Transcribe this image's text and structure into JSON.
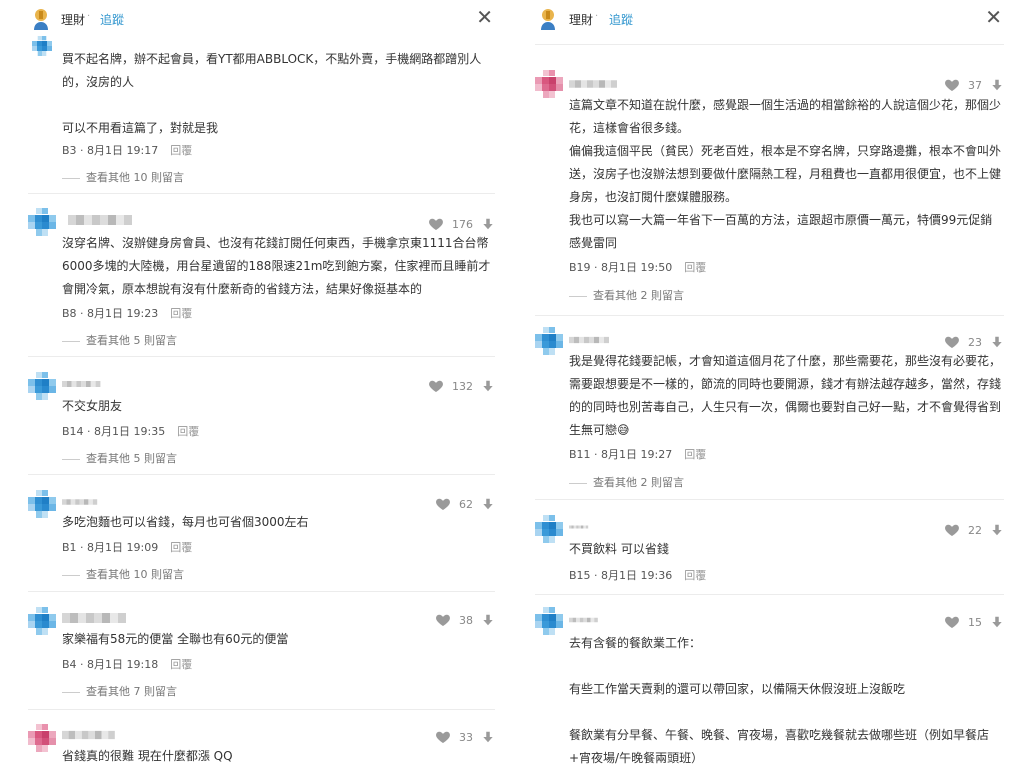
{
  "header": {
    "forum": "理財",
    "dot": "·",
    "follow": "追蹤"
  },
  "left": {
    "comments": [
      {
        "body": "買不起名牌，辦不起會員，看YT都用ABBLOCK，不點外賣，手機網路都蹭別人的，沒房的人\n\n可以不用看這篇了，對就是我",
        "floor": "B3 · 8月1日 19:17",
        "reply": "回覆",
        "more": "查看其他 10 則留言",
        "likes": ""
      },
      {
        "body": "沒穿名牌、沒辦健身房會員、也沒有花錢訂閱任何東西，手機拿京東1111合台幣6000多塊的大陸機，用台星遺留的188限速21m吃到飽方案，住家裡而且睡前才會開冷氣，原本想說有沒有什麼新奇的省錢方法，結果好像挺基本的",
        "floor": "B8 · 8月1日 19:23",
        "reply": "回覆",
        "more": "查看其他 5 則留言",
        "likes": "176"
      },
      {
        "body": "不交女朋友",
        "floor": "B14 · 8月1日 19:35",
        "reply": "回覆",
        "more": "查看其他 5 則留言",
        "likes": "132"
      },
      {
        "body": "多吃泡麵也可以省錢，每月也可省個3000左右",
        "floor": "B1 · 8月1日 19:09",
        "reply": "回覆",
        "more": "查看其他 10 則留言",
        "likes": "62"
      },
      {
        "body": "家樂福有58元的便當 全聯也有60元的便當",
        "floor": "B4 · 8月1日 19:18",
        "reply": "回覆",
        "more": "查看其他 7 則留言",
        "likes": "38"
      },
      {
        "body": "省錢真的很難 現在什麼都漲 QQ",
        "floor": "",
        "reply": "",
        "more": "",
        "likes": "33"
      }
    ]
  },
  "right": {
    "comments": [
      {
        "body": "這篇文章不知道在說什麼，感覺跟一個生活過的相當餘裕的人說這個少花，那個少花，這樣會省很多錢。\n偏偏我這個平民（貧民）死老百姓，根本是不穿名牌，只穿路邊攤，根本不會叫外送，沒房子也沒辦法想到要做什麼隔熱工程，月租費也一直都用很便宜，也不上健身房，也沒訂閱什麼媒體服務。\n我也可以寫一大篇一年省下一百萬的方法，這跟超市原價一萬元，特價99元促銷感覺雷同",
        "floor": "B19 · 8月1日 19:50",
        "reply": "回覆",
        "more": "查看其他 2 則留言",
        "likes": "37"
      },
      {
        "body": "我是覺得花錢要記帳，才會知道這個月花了什麼，那些需要花，那些沒有必要花，需要跟想要是不一樣的，節流的同時也要開源，錢才有辦法越存越多，當然，存錢的的同時也別苦毒自己，人生只有一次，偶爾也要對自己好一點，才不會覺得省到生無可戀😅",
        "floor": "B11 · 8月1日 19:27",
        "reply": "回覆",
        "more": "查看其他 2 則留言",
        "likes": "23"
      },
      {
        "body": "不買飲料 可以省錢",
        "floor": "B15 · 8月1日 19:36",
        "reply": "回覆",
        "more": "",
        "likes": "22"
      },
      {
        "body": "去有含餐的餐飲業工作：\n\n有些工作當天賣剩的還可以帶回家，以備隔天休假沒班上沒飯吃\n\n餐飲業有分早餐、午餐、晚餐、宵夜場，喜歡吃幾餐就去做哪些班（例如早餐店+宵夜場/午晚餐兩頭班）",
        "floor": "",
        "reply": "",
        "more": "",
        "likes": "15"
      }
    ]
  },
  "colors": {
    "accent": "#3397cf",
    "avatar_blue": "#3a9ad9",
    "avatar_pink": "#d9577f"
  }
}
